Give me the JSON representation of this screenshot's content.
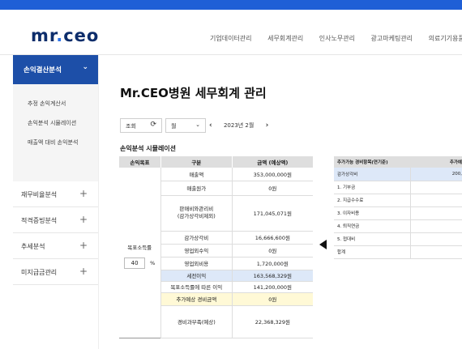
{
  "header": {
    "logo": {
      "prefix": "mr",
      "dot": ".",
      "suffix": "ceo"
    },
    "nav": [
      "기업데이터관리",
      "세무회계관리",
      "인사노무관리",
      "광고마케팅관리",
      "의료기기용품관리"
    ]
  },
  "sidebar": {
    "active": {
      "label": "손익결산분석"
    },
    "sub_items": [
      "추정 손익계산서",
      "손익분석 시뮬레이션",
      "매출액 대비 손익분석"
    ],
    "items": [
      {
        "label": "재무비율분석"
      },
      {
        "label": "적격증빙분석"
      },
      {
        "label": "추세분석"
      },
      {
        "label": "미지급금관리"
      }
    ]
  },
  "main": {
    "title": "Mr.CEO병원 세무회계 관리",
    "controls": {
      "query_label": "조회",
      "period_value": "월",
      "date_value": "2023년 2월"
    },
    "section_title": "손익분석 시뮬레이션",
    "table": {
      "headers": [
        "손익목표",
        "구분",
        "금액 (예상액)"
      ],
      "goal_label": "목표소득률",
      "goal_value": "40",
      "goal_unit": "%",
      "rows": [
        {
          "label": "매출액",
          "value": "353,000,000원"
        },
        {
          "label": "매출원가",
          "value": "0원"
        },
        {
          "label": "판매비와관리비\n(감가상각비제외)",
          "value": "171,045,071원"
        },
        {
          "label": "감가상각비",
          "value": "16,666,600원"
        },
        {
          "label": "영업외수익",
          "value": "0원"
        },
        {
          "label": "영업외비용",
          "value": "1,720,000원"
        },
        {
          "label": "세전이익",
          "value": "163,568,329원",
          "highlight": "blue"
        },
        {
          "label": "목표소득률에 따른 이익",
          "value": "141,200,000원"
        },
        {
          "label": "추가예상 경비금액",
          "value": "0원",
          "highlight": "yellow"
        },
        {
          "label": "경비과부족(예상)",
          "value": "22,368,329원"
        }
      ]
    },
    "expense_table": {
      "headers": [
        "추가가능 경비항목(연기준)",
        "추가예"
      ],
      "rows": [
        {
          "label": "감가상각비",
          "value": "200,",
          "highlight": "blue"
        },
        {
          "label": "1. 기부금",
          "value": ""
        },
        {
          "label": "2. 지급수수료",
          "value": ""
        },
        {
          "label": "3. 이자비용",
          "value": ""
        },
        {
          "label": "4. 퇴직연금",
          "value": ""
        },
        {
          "label": "5. 접대비",
          "value": ""
        },
        {
          "label": "합계",
          "value": ""
        }
      ]
    }
  },
  "colors": {
    "brand_blue": "#1f5fd6",
    "sidebar_active": "#1d4fa8",
    "highlight_blue": "#dde8f8",
    "highlight_yellow": "#fff9d6"
  },
  "icons": [
    "refresh-icon",
    "chevron-down-icon",
    "chevron-left-icon",
    "chevron-right-icon",
    "plus-icon",
    "arrow-left-icon"
  ]
}
